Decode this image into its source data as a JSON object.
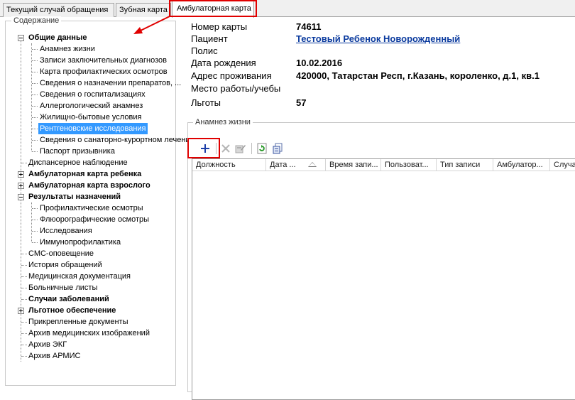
{
  "tabs": [
    {
      "label": "Текущий случай обращения"
    },
    {
      "label": "Зубная карта"
    },
    {
      "label": "Амбулаторная карта"
    }
  ],
  "sidebar": {
    "legend": "Содержание",
    "items": [
      {
        "label": "Общие данные",
        "bold": true
      },
      {
        "label": "Анамнез жизни"
      },
      {
        "label": "Записи заключительных диагнозов"
      },
      {
        "label": "Карта профилактических осмотров"
      },
      {
        "label": "Сведения о назначении препаратов, ..."
      },
      {
        "label": "Сведения о госпитализациях"
      },
      {
        "label": "Аллергологический анамнез"
      },
      {
        "label": "Жилищно-бытовые условия"
      },
      {
        "label": "Рентгеновские исследования",
        "selected": true
      },
      {
        "label": "Сведения о санаторно-курортном лечении"
      },
      {
        "label": "Паспорт призывника"
      },
      {
        "label": "Диспансерное наблюдение"
      },
      {
        "label": "Амбулаторная карта ребенка",
        "bold": true
      },
      {
        "label": "Амбулаторная карта взрослого",
        "bold": true
      },
      {
        "label": "Результаты назначений",
        "bold": true
      },
      {
        "label": "Профилактические осмотры"
      },
      {
        "label": "Флюорографические осмотры"
      },
      {
        "label": "Исследования"
      },
      {
        "label": "Иммунопрофилактика"
      },
      {
        "label": "СМС-оповещение"
      },
      {
        "label": "История обращений"
      },
      {
        "label": "Медицинская документация"
      },
      {
        "label": "Больничные листы"
      },
      {
        "label": "Случаи заболеваний",
        "bold": true
      },
      {
        "label": "Льготное обеспечение",
        "bold": true
      },
      {
        "label": "Прикрепленные документы"
      },
      {
        "label": "Архив медицинских изображений"
      },
      {
        "label": "Архив ЭКГ"
      },
      {
        "label": "Архив АРМИС"
      }
    ]
  },
  "patient": {
    "card_number_label": "Номер карты",
    "card_number": "74611",
    "patient_label": "Пациент",
    "patient_name": "Тестовый Ребенок Новорожденный",
    "policy_label": "Полис",
    "policy": "",
    "birth_label": "Дата рождения",
    "birth_date": "10.02.2016",
    "address_label": "Адрес проживания",
    "address": "420000, Татарстан Респ, г.Казань, короленко, д.1, кв.1",
    "work_label": "Место работы/учебы",
    "work": "",
    "benefits_label": "Льготы",
    "benefits": "57"
  },
  "anamnesis": {
    "legend": "Анамнез жизни",
    "columns": [
      "Должность",
      "Дата ...",
      "Время запи...",
      "Пользоват...",
      "Тип записи",
      "Амбулатор...",
      "Случа..."
    ]
  },
  "icons": {
    "add": "plus-icon",
    "delete": "delete-x-icon",
    "edit": "edit-icon",
    "refresh": "refresh-icon",
    "export": "export-icon"
  },
  "colors": {
    "selection": "#3399ff",
    "highlight_frame": "#e00000",
    "link": "#0a3a9e",
    "add_icon": "#1c3ea8"
  }
}
